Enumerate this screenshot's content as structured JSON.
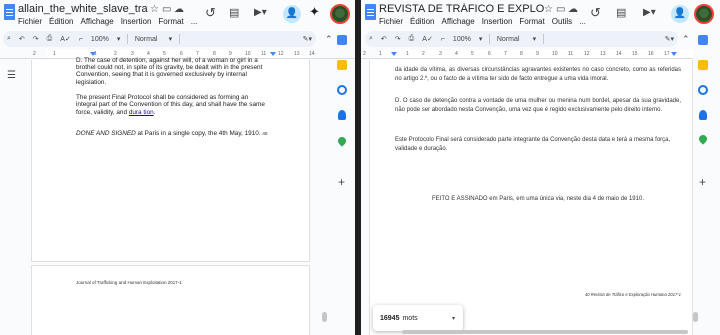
{
  "left": {
    "title": "allain_the_white_slave_traffic_in...",
    "menus": [
      "Fichier",
      "Édition",
      "Affichage",
      "Insertion",
      "Format",
      "..."
    ],
    "toolbar": {
      "zoom": "100%",
      "style": "Normal"
    },
    "ruler_numbers": [
      "2",
      "1",
      "1",
      "2",
      "3",
      "4",
      "5",
      "6",
      "7",
      "8",
      "9",
      "10",
      "11",
      "12",
      "13",
      "14"
    ],
    "body": {
      "line_cut": "D. The case of detention, against her will, of a woman or girl in a",
      "p1": "brothel could not, in spite of its gravity, be dealt with in the present Convention, seeing that it is governed exclusively by internal legislation.",
      "p2_a": "The present Final Protocol shall be considered as forming an integral part of the Convention of this day, and shall have the same force, validity, and ",
      "p2_link": "dura tion",
      "p2_b": ".",
      "p3_italic": "DONE AND SIGNED",
      "p3_rest": " at Paris in a single copy, the 4th May, 1910.",
      "p3_page": "40",
      "footer": "Journal of Trafficking and Human Exploitation 2017-1"
    }
  },
  "right": {
    "title": "REVISTA DE TRÁFICO E EXPLORAÇÃ...",
    "menus": [
      "Fichier",
      "Édition",
      "Affichage",
      "Insertion",
      "Format",
      "Outils",
      "..."
    ],
    "toolbar": {
      "zoom": "100%",
      "style": "Normal"
    },
    "ruler_numbers": [
      "2",
      "1",
      "1",
      "2",
      "3",
      "4",
      "5",
      "6",
      "7",
      "8",
      "9",
      "10",
      "11",
      "12",
      "13",
      "14",
      "15",
      "16",
      "17"
    ],
    "body": {
      "p1": "da idade da vítima, as diversas circunstâncias agravantes existentes no caso concreto, como as referidas no artigo 2.º, ou o facto de a vítima ter sido de facto entregue a uma vida imoral.",
      "p2": "D. O caso de detenção contra a vontade de uma mulher ou menina num bordel, apesar da sua gravidade, não pode ser abordado nesta Convenção, uma vez que é regido exclusivamente pelo direito interno.",
      "p3": "Este Protocolo Final será considerado parte integrante da Convenção desta data e terá a mesma força, validade e duração.",
      "p4": "FEITO E ASSINADO em Paris, em uma única via, neste dia 4 de maio de 1910.",
      "footer": "40 Revista de Tráfico e Exploração Humana 2017-1"
    },
    "word_count": {
      "value": "16945",
      "label": "mots"
    }
  },
  "colors": {
    "share_bg": "#c2e7ff",
    "accent": "#0b57d0",
    "page_bg": "#f9fbfd"
  }
}
